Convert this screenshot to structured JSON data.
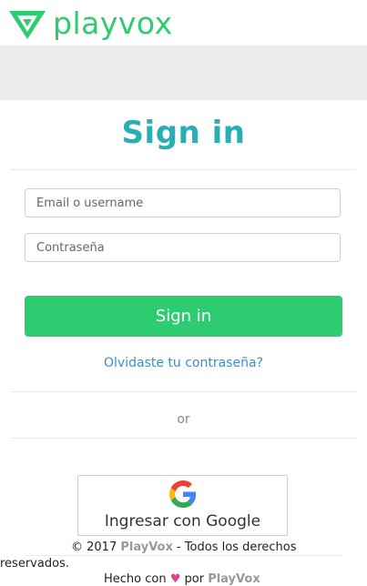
{
  "header": {
    "logo_text": "playvox"
  },
  "signin": {
    "title": "Sign in",
    "email_placeholder": "Email o username",
    "password_placeholder": "Contraseña",
    "submit_label": "Sign in",
    "forgot_label": "Olvidaste tu contraseña?",
    "divider_label": "or",
    "google_label": "Ingresar con Google"
  },
  "footer": {
    "copyright_prefix": "© 2017 ",
    "brand": "PlayVox",
    "copyright_suffix": " - Todos los derechos",
    "copyright_suffix2": "reservados.",
    "made_with": "Hecho con ",
    "heart": "♥",
    "by": " por ",
    "brand2": "PlayVox"
  },
  "colors": {
    "accent_green": "#2ecc71",
    "title_teal": "#29aeb4",
    "link_blue": "#3a8fc9"
  }
}
